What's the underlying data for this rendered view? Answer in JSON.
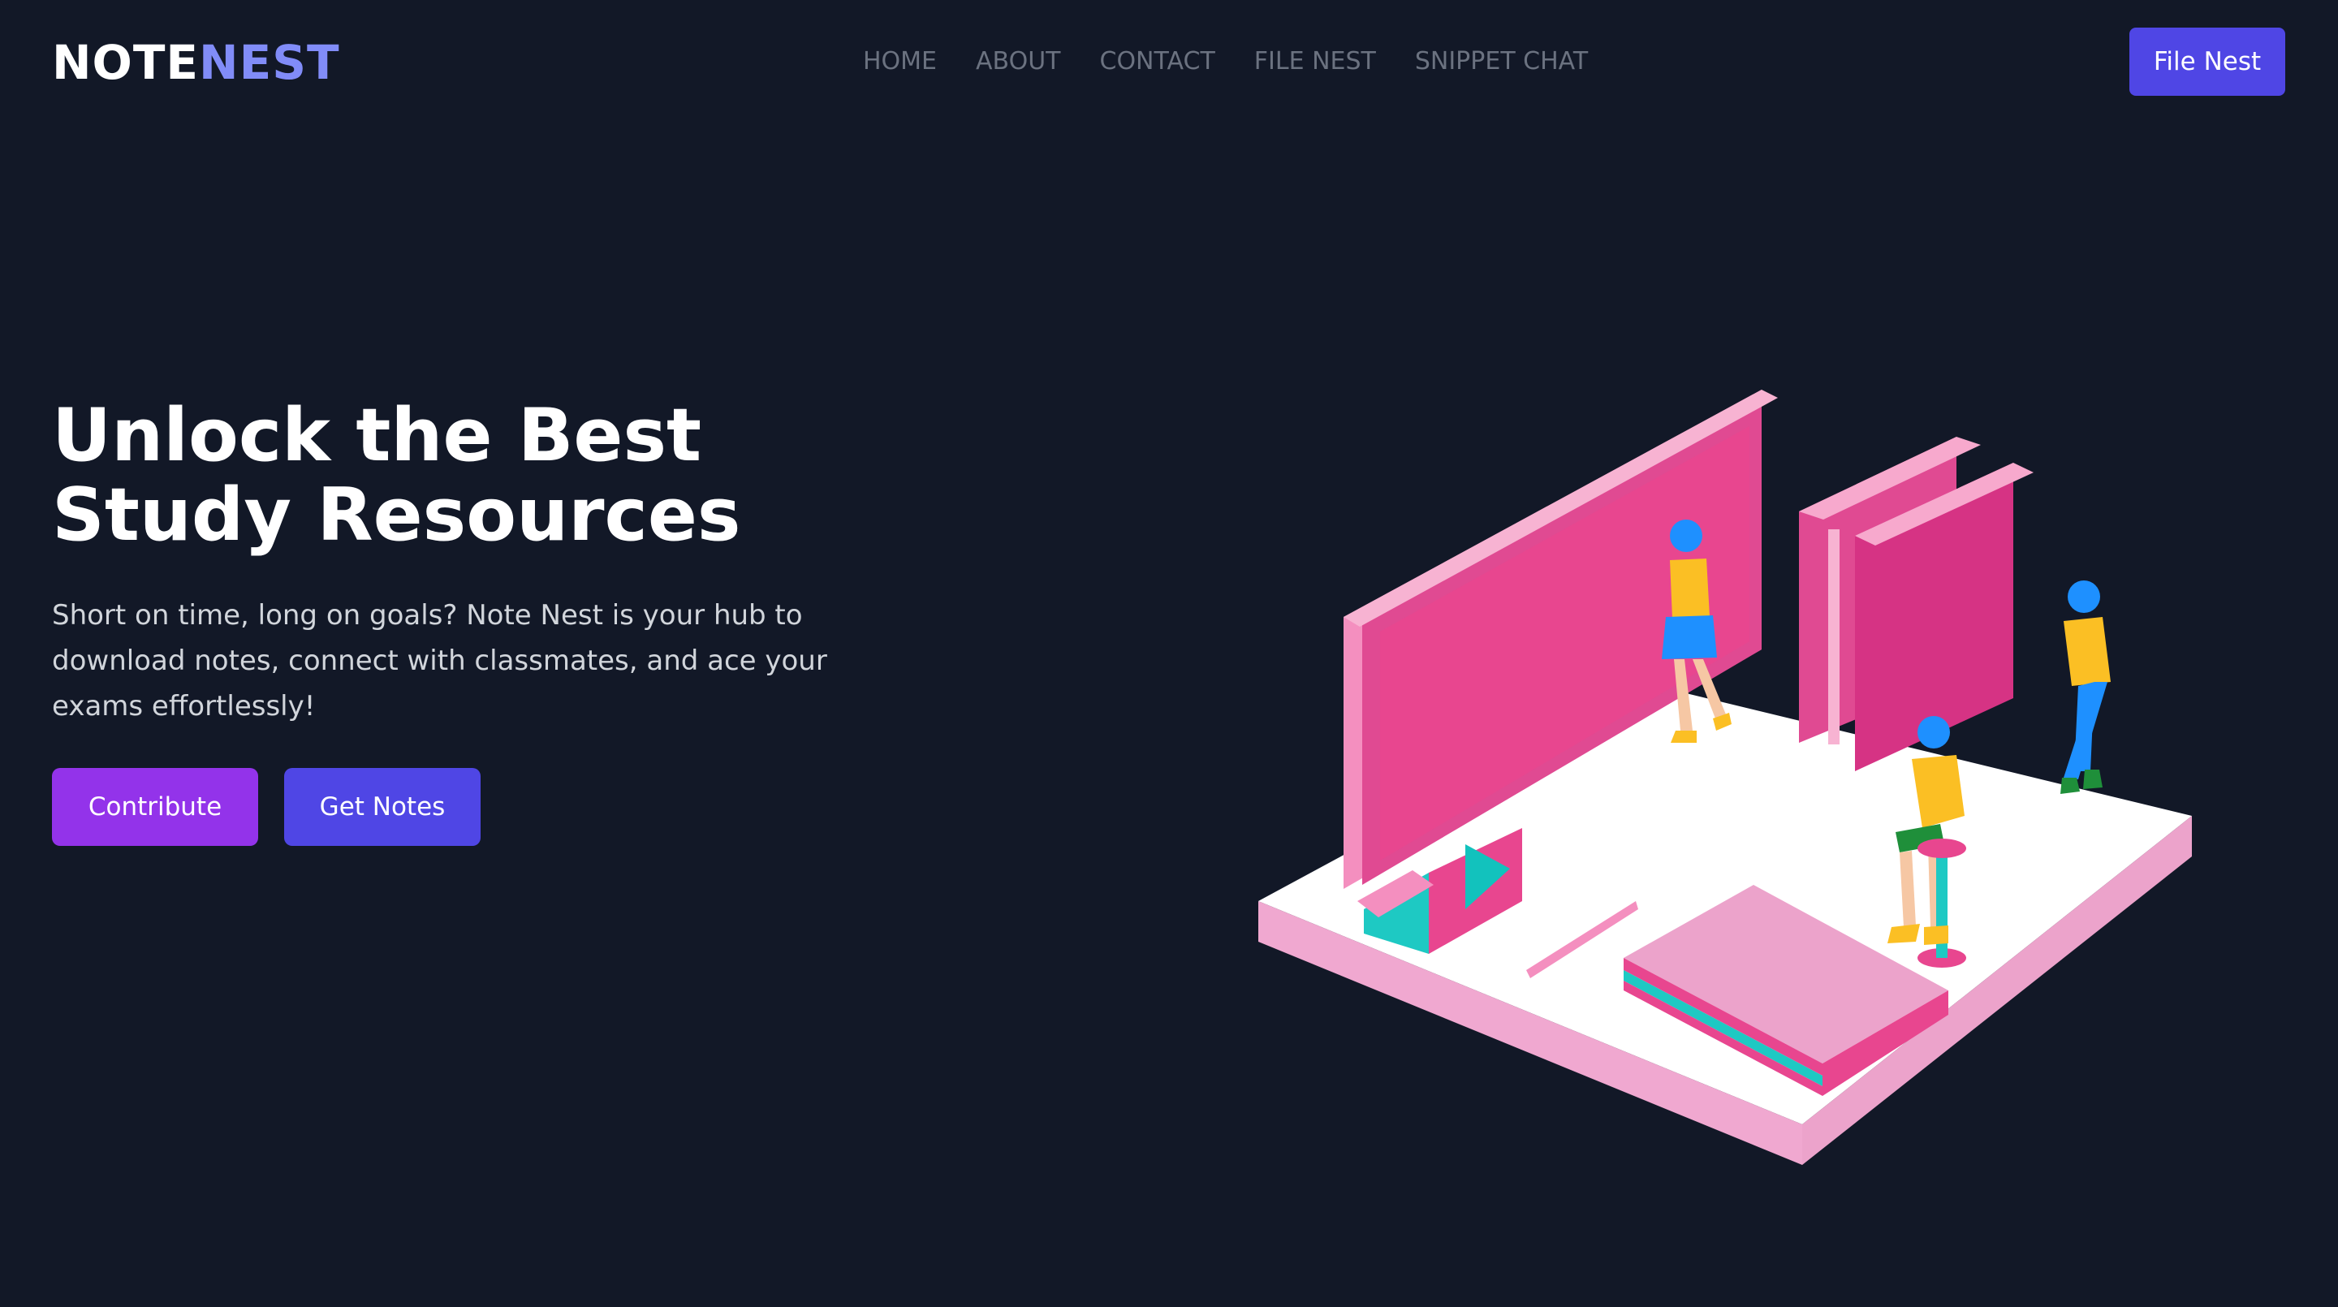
{
  "header": {
    "logo_part1": "NOTE",
    "logo_part2": "NEST",
    "nav": [
      "HOME",
      "ABOUT",
      "CONTACT",
      "FILE NEST",
      "SNIPPET CHAT"
    ],
    "cta_label": "File Nest"
  },
  "hero": {
    "title": "Unlock the Best Study Resources",
    "description": "Short on time, long on goals? Note Nest is your hub to download notes, connect with classmates, and ace your exams effortlessly!",
    "buttons": {
      "contribute": "Contribute",
      "get_notes": "Get Notes"
    }
  },
  "colors": {
    "background": "#121827",
    "accent_indigo": "#4f46e5",
    "accent_purple": "#9333ea",
    "logo_accent": "#818cf8",
    "nav_text": "#6b7280"
  },
  "illustration": {
    "icon": "study-isometric-illustration"
  }
}
